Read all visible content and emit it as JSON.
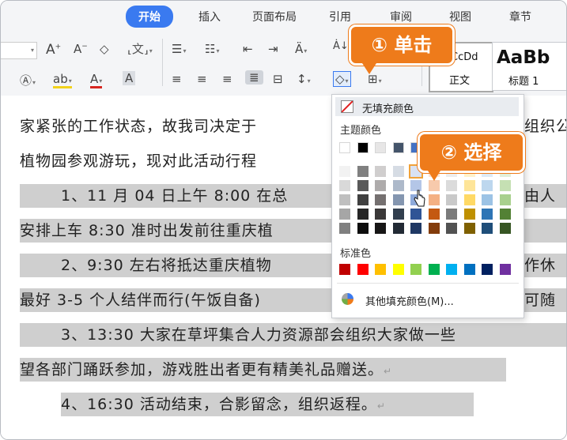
{
  "tabs": [
    {
      "label": "开始",
      "active": true
    },
    {
      "label": "插入"
    },
    {
      "label": "页面布局"
    },
    {
      "label": "引用"
    },
    {
      "label": "审阅"
    },
    {
      "label": "视图"
    },
    {
      "label": "章节"
    }
  ],
  "ribbon": {
    "styles": {
      "normal_preview": "CcDd",
      "normal_label": "正文",
      "h1_preview": "AaBb",
      "h1_label": "标题 1"
    }
  },
  "document": {
    "lines": [
      "家紧张的工作状态，故我司决定于",
      "植物园参观游玩，现对此活动行程",
      "1、11 月 04 日上午 8:00 在总",
      "安排上车 8:30 准时出发前往重庆植",
      "2、9:30 左右将抵达重庆植物",
      "最好 3-5 个人结伴而行(午饭自备)",
      "3、13:30 大家在草坪集合人力资源部会组织大家做一些",
      "望各部门踊跃参加，游戏胜出者更有精美礼品赠送。",
      "4、16:30 活动结束，合影留念，组织返程。"
    ],
    "right_fragments": [
      "组织公",
      "由人",
      "作休",
      "可随"
    ]
  },
  "fill_menu": {
    "no_fill": "无填充颜色",
    "theme_label": "主题颜色",
    "standard_label": "标准色",
    "more": "其他填充颜色(M)...",
    "theme_top": [
      "#ffffff",
      "#000000",
      "#e7e6e6",
      "#44546a",
      "#4472c4",
      "#ed7d31",
      "#a5a5a5",
      "#ffc000",
      "#5b9bd5",
      "#70ad47"
    ],
    "theme_shades": [
      [
        "#f2f2f2",
        "#808080",
        "#d0cece",
        "#d6dce4",
        "#d9e2f3",
        "#fbe4d5",
        "#ededed",
        "#fff2cc",
        "#deebf6",
        "#e2efd9"
      ],
      [
        "#d9d9d9",
        "#595959",
        "#aeabab",
        "#adb9ca",
        "#b4c6e7",
        "#f7caac",
        "#dbdbdb",
        "#fee599",
        "#bdd7ee",
        "#c5e0b3"
      ],
      [
        "#bfbfbf",
        "#404040",
        "#757070",
        "#8496b0",
        "#8eaadb",
        "#f4b083",
        "#c9c9c9",
        "#ffd965",
        "#9cc3e5",
        "#a8d08d"
      ],
      [
        "#a6a6a6",
        "#262626",
        "#3a3838",
        "#323f4f",
        "#2f5496",
        "#c45911",
        "#7b7b7b",
        "#bf9000",
        "#2e75b5",
        "#538135"
      ],
      [
        "#808080",
        "#0d0d0d",
        "#171616",
        "#222a35",
        "#1f3864",
        "#833c0b",
        "#525252",
        "#7f6000",
        "#1f4e79",
        "#375623"
      ]
    ],
    "standard": [
      "#c00000",
      "#ff0000",
      "#ffc000",
      "#ffff00",
      "#92d050",
      "#00b050",
      "#00b0f0",
      "#0070c0",
      "#002060",
      "#7030a0"
    ]
  },
  "callouts": {
    "click": "① 单击",
    "select": "② 选择"
  },
  "colors": {
    "accent": "#3a7af0",
    "callout": "#ee7b1b",
    "highlight": "#cfcfcf"
  }
}
